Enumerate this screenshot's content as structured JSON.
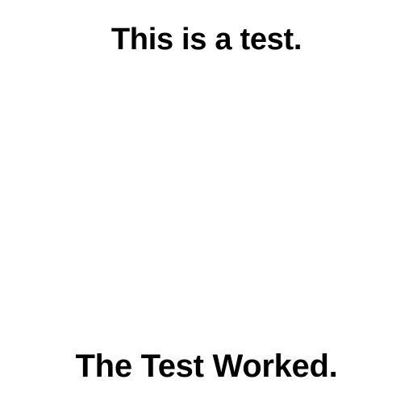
{
  "header": {
    "text": "This is a test."
  },
  "footer": {
    "text": "The Test Worked."
  },
  "colors": {
    "background": "#ffffff",
    "text": "#000000"
  }
}
